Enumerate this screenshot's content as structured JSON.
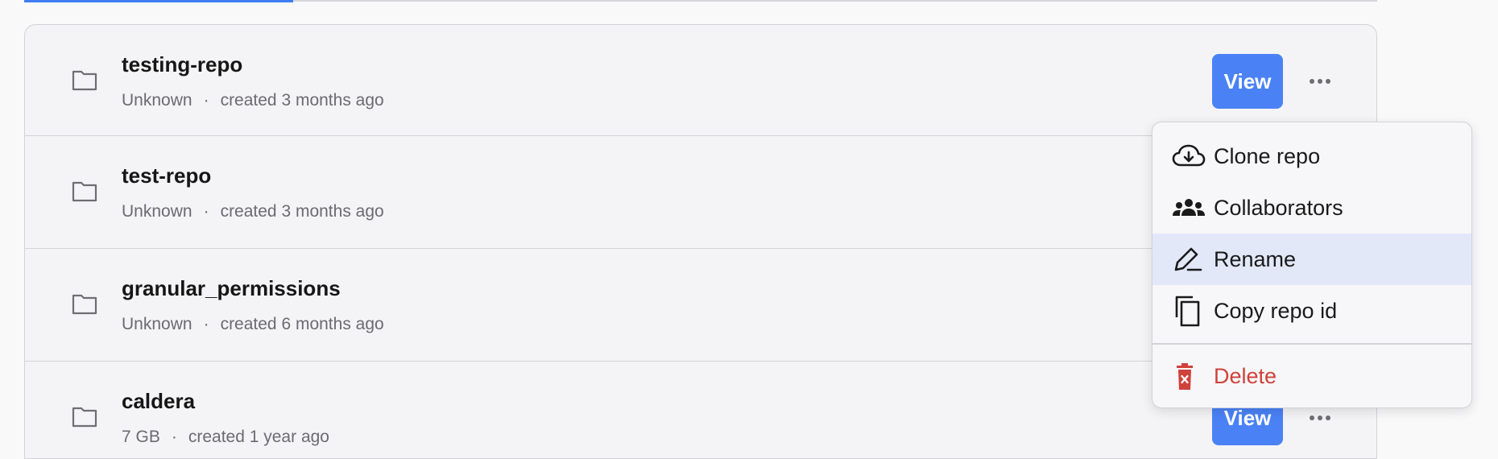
{
  "repos": [
    {
      "name": "testing-repo",
      "size": "Unknown",
      "created": "created 3 months ago",
      "view_label": "View"
    },
    {
      "name": "test-repo",
      "size": "Unknown",
      "created": "created 3 months ago",
      "view_label": "View"
    },
    {
      "name": "granular_permissions",
      "size": "Unknown",
      "created": "created 6 months ago",
      "view_label": "View"
    },
    {
      "name": "caldera",
      "size": "7 GB",
      "created": "created 1 year ago",
      "view_label": "View"
    }
  ],
  "meta_separator": "·",
  "menu": {
    "items": [
      {
        "label": "Clone repo",
        "icon": "cloud-download-icon"
      },
      {
        "label": "Collaborators",
        "icon": "people-icon"
      },
      {
        "label": "Rename",
        "icon": "pencil-icon",
        "highlighted": true
      },
      {
        "label": "Copy repo id",
        "icon": "copy-icon"
      }
    ],
    "danger_item": {
      "label": "Delete",
      "icon": "trash-icon"
    }
  },
  "colors": {
    "accent": "#4a82f6",
    "danger": "#d0413b",
    "highlight": "#e2e8f8"
  }
}
